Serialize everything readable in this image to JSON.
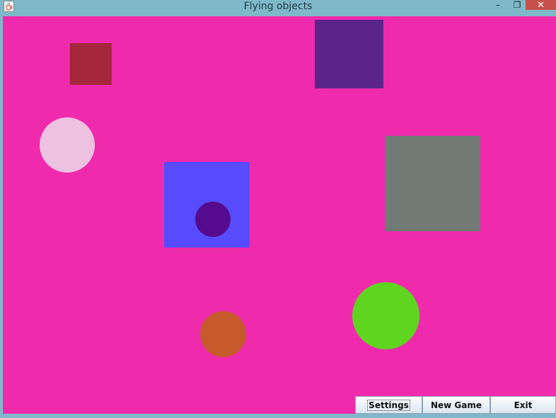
{
  "window": {
    "title": "Flying objects",
    "app_icon": "java-cup-icon",
    "minimize_glyph": "–",
    "maximize_glyph": "❐",
    "close_glyph": "✕"
  },
  "canvas": {
    "background": "#f02aad",
    "objects": [
      {
        "name": "red-square",
        "color": "#a3263a",
        "shape": "square"
      },
      {
        "name": "purple-square",
        "color": "#5a248c",
        "shape": "square"
      },
      {
        "name": "pink-circle",
        "color": "#edc2e0",
        "shape": "circle"
      },
      {
        "name": "blue-square",
        "color": "#574bfd",
        "shape": "square"
      },
      {
        "name": "indigo-circle",
        "color": "#560b8e",
        "shape": "circle"
      },
      {
        "name": "gray-square",
        "color": "#727a75",
        "shape": "square"
      },
      {
        "name": "green-circle",
        "color": "#5fd520",
        "shape": "circle"
      },
      {
        "name": "orange-circle",
        "color": "#c65a2a",
        "shape": "circle"
      }
    ]
  },
  "buttons": {
    "settings": "Settings",
    "new_game": "New Game",
    "exit": "Exit"
  }
}
